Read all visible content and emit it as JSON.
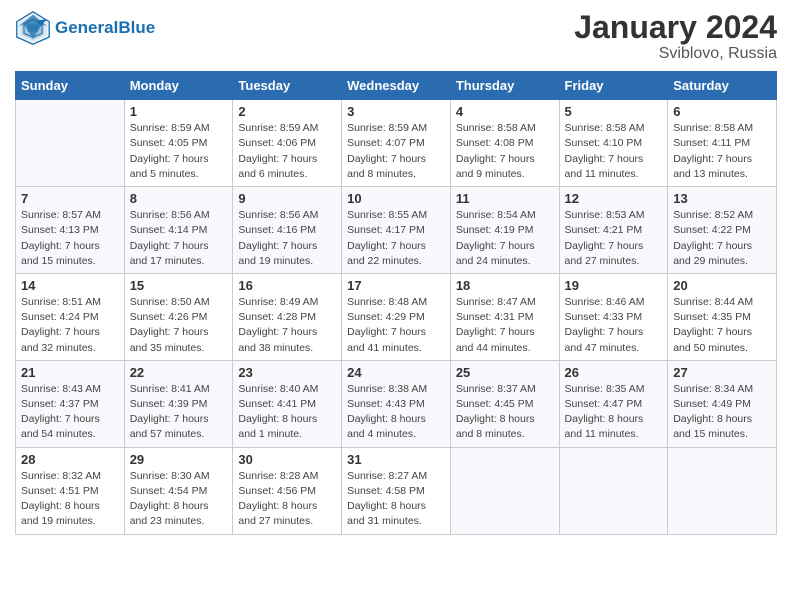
{
  "header": {
    "logo_general": "General",
    "logo_blue": "Blue",
    "month_title": "January 2024",
    "location": "Sviblovo, Russia"
  },
  "days_of_week": [
    "Sunday",
    "Monday",
    "Tuesday",
    "Wednesday",
    "Thursday",
    "Friday",
    "Saturday"
  ],
  "weeks": [
    [
      {
        "day": "",
        "info": ""
      },
      {
        "day": "1",
        "info": "Sunrise: 8:59 AM\nSunset: 4:05 PM\nDaylight: 7 hours\nand 5 minutes."
      },
      {
        "day": "2",
        "info": "Sunrise: 8:59 AM\nSunset: 4:06 PM\nDaylight: 7 hours\nand 6 minutes."
      },
      {
        "day": "3",
        "info": "Sunrise: 8:59 AM\nSunset: 4:07 PM\nDaylight: 7 hours\nand 8 minutes."
      },
      {
        "day": "4",
        "info": "Sunrise: 8:58 AM\nSunset: 4:08 PM\nDaylight: 7 hours\nand 9 minutes."
      },
      {
        "day": "5",
        "info": "Sunrise: 8:58 AM\nSunset: 4:10 PM\nDaylight: 7 hours\nand 11 minutes."
      },
      {
        "day": "6",
        "info": "Sunrise: 8:58 AM\nSunset: 4:11 PM\nDaylight: 7 hours\nand 13 minutes."
      }
    ],
    [
      {
        "day": "7",
        "info": "Sunrise: 8:57 AM\nSunset: 4:13 PM\nDaylight: 7 hours\nand 15 minutes."
      },
      {
        "day": "8",
        "info": "Sunrise: 8:56 AM\nSunset: 4:14 PM\nDaylight: 7 hours\nand 17 minutes."
      },
      {
        "day": "9",
        "info": "Sunrise: 8:56 AM\nSunset: 4:16 PM\nDaylight: 7 hours\nand 19 minutes."
      },
      {
        "day": "10",
        "info": "Sunrise: 8:55 AM\nSunset: 4:17 PM\nDaylight: 7 hours\nand 22 minutes."
      },
      {
        "day": "11",
        "info": "Sunrise: 8:54 AM\nSunset: 4:19 PM\nDaylight: 7 hours\nand 24 minutes."
      },
      {
        "day": "12",
        "info": "Sunrise: 8:53 AM\nSunset: 4:21 PM\nDaylight: 7 hours\nand 27 minutes."
      },
      {
        "day": "13",
        "info": "Sunrise: 8:52 AM\nSunset: 4:22 PM\nDaylight: 7 hours\nand 29 minutes."
      }
    ],
    [
      {
        "day": "14",
        "info": "Sunrise: 8:51 AM\nSunset: 4:24 PM\nDaylight: 7 hours\nand 32 minutes."
      },
      {
        "day": "15",
        "info": "Sunrise: 8:50 AM\nSunset: 4:26 PM\nDaylight: 7 hours\nand 35 minutes."
      },
      {
        "day": "16",
        "info": "Sunrise: 8:49 AM\nSunset: 4:28 PM\nDaylight: 7 hours\nand 38 minutes."
      },
      {
        "day": "17",
        "info": "Sunrise: 8:48 AM\nSunset: 4:29 PM\nDaylight: 7 hours\nand 41 minutes."
      },
      {
        "day": "18",
        "info": "Sunrise: 8:47 AM\nSunset: 4:31 PM\nDaylight: 7 hours\nand 44 minutes."
      },
      {
        "day": "19",
        "info": "Sunrise: 8:46 AM\nSunset: 4:33 PM\nDaylight: 7 hours\nand 47 minutes."
      },
      {
        "day": "20",
        "info": "Sunrise: 8:44 AM\nSunset: 4:35 PM\nDaylight: 7 hours\nand 50 minutes."
      }
    ],
    [
      {
        "day": "21",
        "info": "Sunrise: 8:43 AM\nSunset: 4:37 PM\nDaylight: 7 hours\nand 54 minutes."
      },
      {
        "day": "22",
        "info": "Sunrise: 8:41 AM\nSunset: 4:39 PM\nDaylight: 7 hours\nand 57 minutes."
      },
      {
        "day": "23",
        "info": "Sunrise: 8:40 AM\nSunset: 4:41 PM\nDaylight: 8 hours\nand 1 minute."
      },
      {
        "day": "24",
        "info": "Sunrise: 8:38 AM\nSunset: 4:43 PM\nDaylight: 8 hours\nand 4 minutes."
      },
      {
        "day": "25",
        "info": "Sunrise: 8:37 AM\nSunset: 4:45 PM\nDaylight: 8 hours\nand 8 minutes."
      },
      {
        "day": "26",
        "info": "Sunrise: 8:35 AM\nSunset: 4:47 PM\nDaylight: 8 hours\nand 11 minutes."
      },
      {
        "day": "27",
        "info": "Sunrise: 8:34 AM\nSunset: 4:49 PM\nDaylight: 8 hours\nand 15 minutes."
      }
    ],
    [
      {
        "day": "28",
        "info": "Sunrise: 8:32 AM\nSunset: 4:51 PM\nDaylight: 8 hours\nand 19 minutes."
      },
      {
        "day": "29",
        "info": "Sunrise: 8:30 AM\nSunset: 4:54 PM\nDaylight: 8 hours\nand 23 minutes."
      },
      {
        "day": "30",
        "info": "Sunrise: 8:28 AM\nSunset: 4:56 PM\nDaylight: 8 hours\nand 27 minutes."
      },
      {
        "day": "31",
        "info": "Sunrise: 8:27 AM\nSunset: 4:58 PM\nDaylight: 8 hours\nand 31 minutes."
      },
      {
        "day": "",
        "info": ""
      },
      {
        "day": "",
        "info": ""
      },
      {
        "day": "",
        "info": ""
      }
    ]
  ]
}
